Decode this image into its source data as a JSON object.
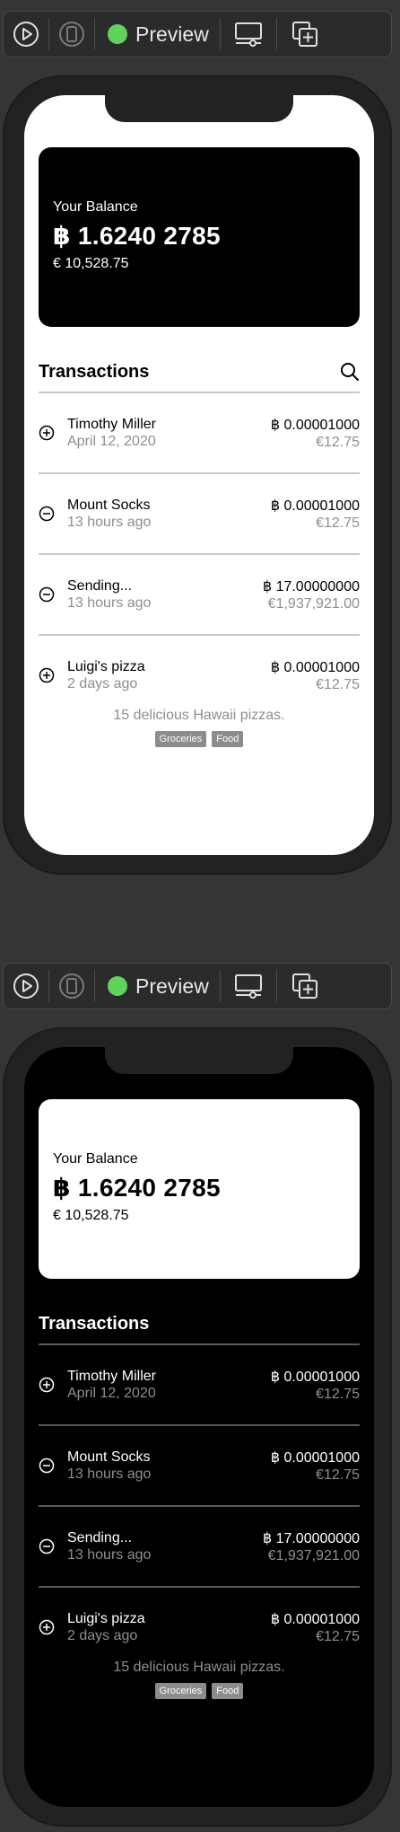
{
  "toolbar": {
    "preview_label": "Preview"
  },
  "balance": {
    "label": "Your Balance",
    "btc": "฿ 1.6240 2785",
    "fiat": "€ 10,528.75"
  },
  "transactions": {
    "title": "Transactions",
    "items": [
      {
        "type": "incoming",
        "name": "Timothy Miller",
        "time": "April 12, 2020",
        "btc": "฿ 0.00001000",
        "eur": "€12.75"
      },
      {
        "type": "outgoing",
        "name": "Mount Socks",
        "time": "13 hours ago",
        "btc": "฿ 0.00001000",
        "eur": "€12.75"
      },
      {
        "type": "outgoing",
        "name": "Sending...",
        "time": "13 hours ago",
        "btc": "฿ 17.00000000",
        "eur": "€1,937,921.00"
      },
      {
        "type": "incoming",
        "name": "Luigi's pizza",
        "time": "2 days ago",
        "btc": "฿ 0.00001000",
        "eur": "€12.75"
      }
    ],
    "note": "15 delicious Hawaii pizzas.",
    "tags": [
      "Groceries",
      "Food"
    ]
  },
  "colors": {
    "preview_dot": "#5fd35a",
    "background": "#353535"
  },
  "icons": [
    "play-icon",
    "device-icon",
    "display-settings-icon",
    "duplicate-icon",
    "search-icon",
    "plus-circle-icon",
    "minus-circle-icon"
  ]
}
